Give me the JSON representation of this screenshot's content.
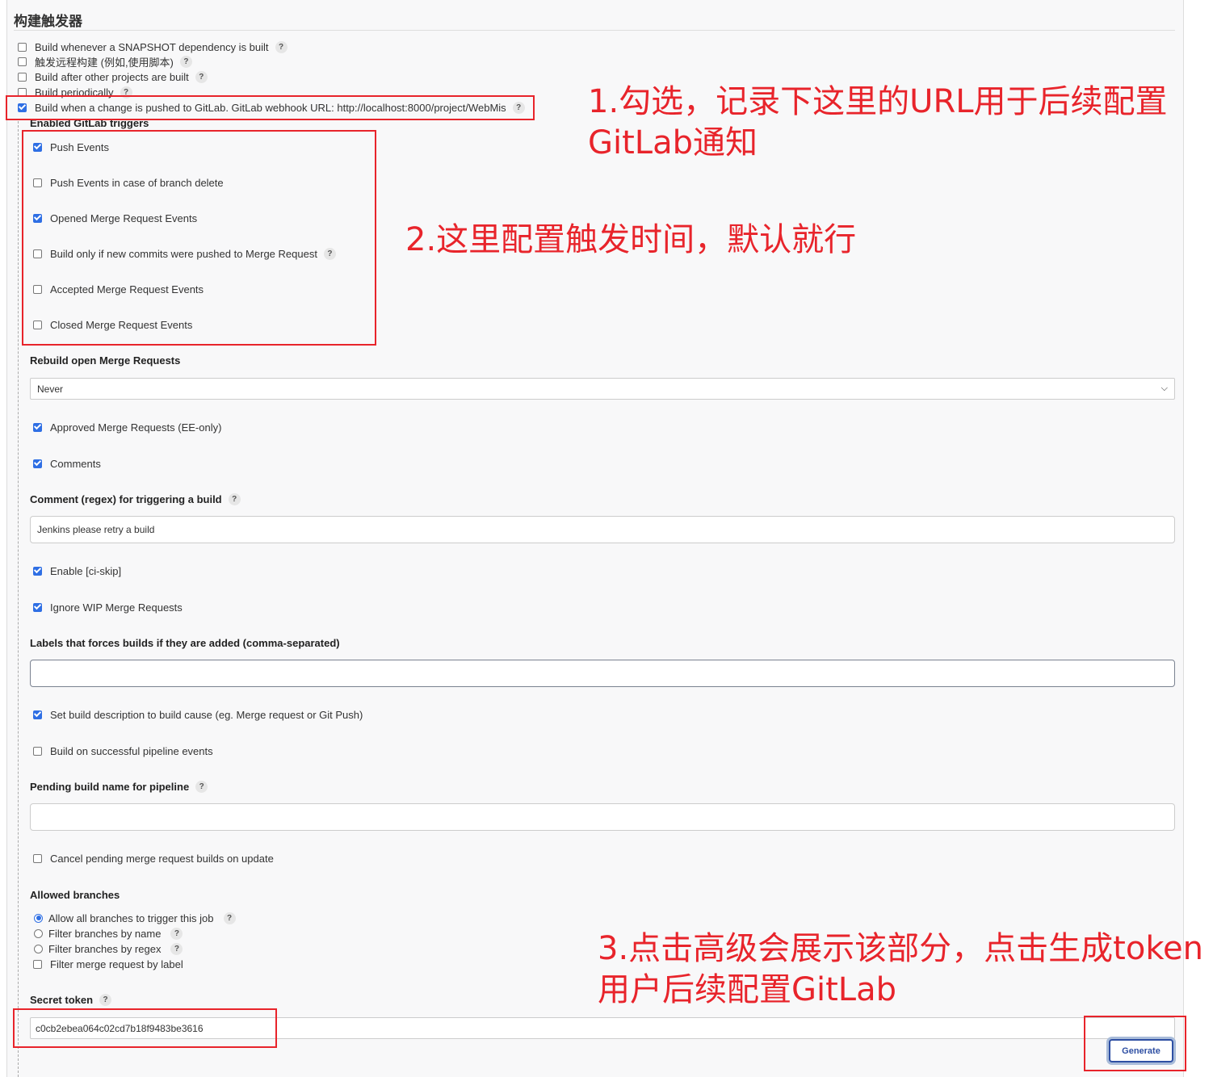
{
  "section_title": "构建触发器",
  "triggers": [
    {
      "label": "Build whenever a SNAPSHOT dependency is built",
      "checked": false,
      "help": "?"
    },
    {
      "label": "触发远程构建 (例如,使用脚本)",
      "checked": false,
      "help": "?"
    },
    {
      "label": "Build after other projects are built",
      "checked": false,
      "help": "?"
    },
    {
      "label": "Build periodically",
      "checked": false,
      "help": "?"
    },
    {
      "label": "Build when a change is pushed to GitLab. GitLab webhook URL: http://localhost:8000/project/WebMis",
      "checked": true,
      "help": "?"
    }
  ],
  "gitlab": {
    "enabled_triggers_label": "Enabled GitLab triggers",
    "events": [
      {
        "label": "Push Events",
        "checked": true
      },
      {
        "label": "Push Events in case of branch delete",
        "checked": false
      },
      {
        "label": "Opened Merge Request Events",
        "checked": true
      },
      {
        "label": "Build only if new commits were pushed to Merge Request",
        "checked": false,
        "help": "?"
      },
      {
        "label": "Accepted Merge Request Events",
        "checked": false
      },
      {
        "label": "Closed Merge Request Events",
        "checked": false
      }
    ],
    "rebuild_label": "Rebuild open Merge Requests",
    "rebuild_value": "Never",
    "approved": {
      "label": "Approved Merge Requests (EE-only)",
      "checked": true
    },
    "comments": {
      "label": "Comments",
      "checked": true
    },
    "comment_regex_label": "Comment (regex) for triggering a build",
    "comment_regex_value": "Jenkins please retry a build",
    "ci_skip": {
      "label": "Enable [ci-skip]",
      "checked": true
    },
    "ignore_wip": {
      "label": "Ignore WIP Merge Requests",
      "checked": true
    },
    "labels_label": "Labels that forces builds if they are added (comma-separated)",
    "labels_value": "",
    "set_desc": {
      "label": "Set build description to build cause (eg. Merge request or Git Push)",
      "checked": true
    },
    "pipeline": {
      "label": "Build on successful pipeline events",
      "checked": false
    },
    "pending_label": "Pending build name for pipeline",
    "pending_value": "",
    "cancel_pending": {
      "label": "Cancel pending merge request builds on update",
      "checked": false
    },
    "allowed_branches_label": "Allowed branches",
    "branch_options": [
      {
        "label": "Allow all branches to trigger this job",
        "selected": true
      },
      {
        "label": "Filter branches by name",
        "selected": false
      },
      {
        "label": "Filter branches by regex",
        "selected": false
      }
    ],
    "filter_label": {
      "label": "Filter merge request by label",
      "checked": false
    },
    "secret_token_label": "Secret token",
    "secret_token_value": "c0cb2ebea064c02cd7b18f9483be3616",
    "generate_label": "Generate"
  },
  "annotations": {
    "note1_line1": "1.勾选，记录下这里的URL用于后续配置",
    "note1_line2": "GitLab通知",
    "note2": "2.这里配置触发时间，默认就行",
    "note3_line1": "3.点击高级会展示该部分，点击生成token",
    "note3_line2": "用户后续配置GitLab",
    "color": "#e8242b"
  },
  "colors": {
    "accent": "#2f6fe4",
    "button": "#2e4fa3"
  }
}
